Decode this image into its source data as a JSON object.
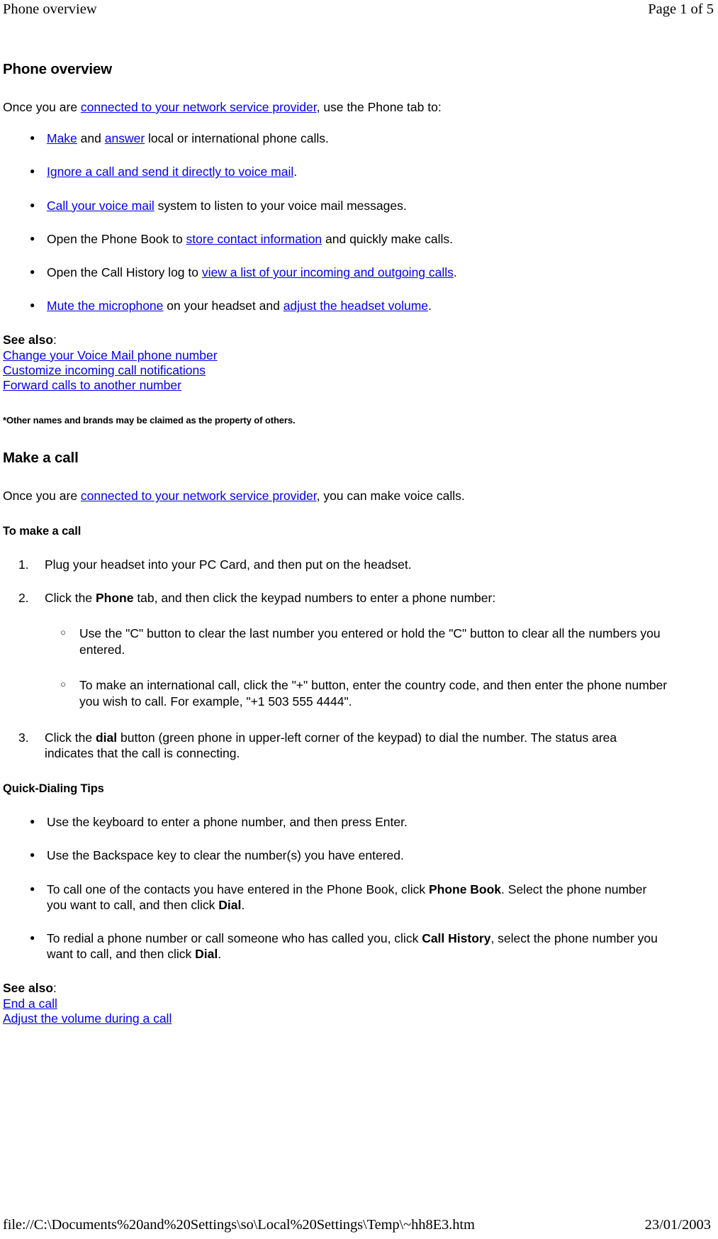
{
  "print_header": {
    "title": "Phone overview",
    "page_label": "Page 1 of 5"
  },
  "print_footer": {
    "path": "file://C:\\Documents%20and%20Settings\\so\\Local%20Settings\\Temp\\~hh8E3.htm",
    "date": "23/01/2003"
  },
  "sections": {
    "overview": {
      "heading": "Phone overview",
      "intro_before_link": "Once you are ",
      "intro_link": "connected to your network service provider",
      "intro_after_link": ", use the Phone tab to:",
      "bullets": {
        "b1_link_a": "Make",
        "b1_mid": " and ",
        "b1_link_b": "answer",
        "b1_tail": " local or international phone calls.",
        "b2_link": "Ignore a call and send it directly to voice mail",
        "b2_tail": ".",
        "b3_link": "Call your voice mail",
        "b3_tail": " system to listen to your voice mail messages.",
        "b4_head": "Open the Phone Book to ",
        "b4_link": "store contact information",
        "b4_tail": " and quickly make calls.",
        "b5_head": "Open the Call History log to ",
        "b5_link": "view a list of your incoming and outgoing calls",
        "b5_tail": ".",
        "b6_link_a": "Mute the microphone",
        "b6_mid": " on your headset and ",
        "b6_link_b": "adjust the headset volume",
        "b6_tail": "."
      },
      "see_also": {
        "label": "See also",
        "colon": ":",
        "links": [
          "Change your Voice Mail phone number",
          "Customize incoming call notifications",
          "Forward calls to another number"
        ]
      },
      "footnote": "*Other names and brands may be claimed as the property of others."
    },
    "make_a_call": {
      "heading": "Make a call",
      "intro_before_link": "Once you are ",
      "intro_link": "connected to your network service provider",
      "intro_after_link": ", you can make voice calls.",
      "subheading": "To make a call",
      "steps": {
        "s1": "Plug your headset into your PC Card, and then put on the headset.",
        "s2_head": "Click the ",
        "s2_bold": "Phone",
        "s2_tail": " tab, and then click the keypad numbers to enter a phone number:",
        "s2_sub1": "Use the \"C\" button to clear the last number you entered or hold the \"C\" button to clear all the numbers you entered.",
        "s2_sub2": "To make an international call, click the \"+\" button, enter the country code, and then enter the phone number you wish to call. For example, \"+1 503 555 4444\".",
        "s3_head": "Click the ",
        "s3_bold": "dial",
        "s3_tail": " button (green phone in upper-left corner of the keypad) to dial the number. The status area indicates that the call is connecting."
      },
      "tips_heading": "Quick-Dialing Tips",
      "tips": {
        "t1": "Use the keyboard to enter a phone number, and then press Enter.",
        "t2": "Use the Backspace key to clear the number(s) you have entered.",
        "t3_head": "To call one of the contacts you have entered in the Phone Book, click ",
        "t3_bold_a": "Phone Book",
        "t3_mid": ". Select the phone number you want to call, and then click ",
        "t3_bold_b": "Dial",
        "t3_tail": ".",
        "t4_head": "To redial a phone number or call someone who has called you, click ",
        "t4_bold_a": "Call History",
        "t4_mid": ", select the phone number you want to call, and then click ",
        "t4_bold_b": "Dial",
        "t4_tail": "."
      },
      "see_also": {
        "label": "See also",
        "colon": ":",
        "links": [
          "End a call",
          "Adjust the volume during a call"
        ]
      }
    }
  },
  "colors": {
    "link": "#0000EE",
    "text": "#000000",
    "background": "#FFFFFF"
  }
}
